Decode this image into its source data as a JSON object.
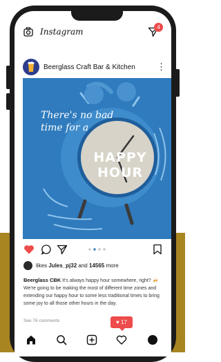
{
  "app": {
    "brand": "Instagram",
    "dm_badge": "4"
  },
  "post": {
    "account": "Beerglass Craft Bar & Kitchen",
    "image": {
      "tagline": "There's no bad time for a",
      "clock_text": "HAPPY HOUR"
    },
    "likes": {
      "prefix": "likes",
      "user": "Jules_pj32",
      "connector": "and",
      "count": "14565",
      "suffix": "more"
    },
    "caption": {
      "author": "Beerglass CBK",
      "text": "It's always happy hour somewhere, right? 🍻 We're going to be making the most of different time zones and extending our happy hour to some less traditional times to bring some joy to all those other hours in the day."
    },
    "comments_link": "See 76 comments"
  },
  "notification": {
    "likes_count": "17"
  },
  "colors": {
    "accent_red": "#ee4b4b",
    "image_blue": "#2f7bbd",
    "background_gold": "#a88520"
  },
  "icons": {
    "top": [
      "camera-icon",
      "direct-message-icon"
    ],
    "actions": [
      "heart-filled-icon",
      "comment-icon",
      "share-icon",
      "bookmark-icon"
    ],
    "nav": [
      "home-icon",
      "search-icon",
      "add-post-icon",
      "activity-heart-icon",
      "profile-icon"
    ]
  }
}
